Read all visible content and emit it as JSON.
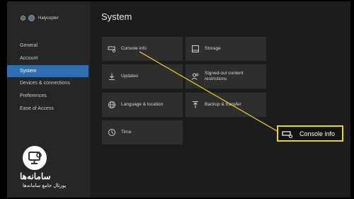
{
  "profile": {
    "gamertag": "Halycopter"
  },
  "nav": [
    {
      "label": "General"
    },
    {
      "label": "Account"
    },
    {
      "label": "System"
    },
    {
      "label": "Devices & connections"
    },
    {
      "label": "Preferences"
    },
    {
      "label": "Ease of Access"
    }
  ],
  "selected_nav": "System",
  "page": {
    "title": "System"
  },
  "tiles": [
    {
      "label": "Console info",
      "icon": "console-icon"
    },
    {
      "label": "Storage",
      "icon": "storage-icon"
    },
    {
      "label": "Updates",
      "icon": "download-icon"
    },
    {
      "label": "Signed-out content restrictions",
      "icon": "users-icon"
    },
    {
      "label": "Language & location",
      "icon": "globe-icon"
    },
    {
      "label": "Backup & transfer",
      "icon": "upload-icon"
    },
    {
      "label": "Time",
      "icon": "clock-icon"
    }
  ],
  "callout": {
    "label": "Console info",
    "icon": "console-icon",
    "border_color": "#f1d21a"
  },
  "watermark": {
    "line1": "سامانه‌ها",
    "line2": "پورتال جامع سامانه‌ها"
  },
  "colors": {
    "accent": "#2f6fb0",
    "highlight": "#f1d21a"
  }
}
